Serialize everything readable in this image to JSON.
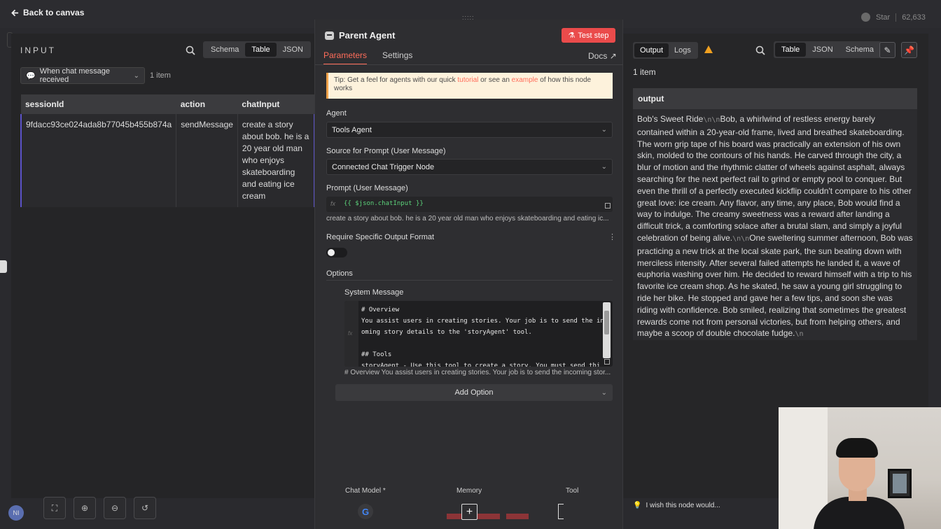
{
  "topbar": {
    "back_label": "Back to canvas",
    "star_label": "Star",
    "star_count": "62,633"
  },
  "input_panel": {
    "title": "INPUT",
    "view_tabs": [
      "Schema",
      "Table",
      "JSON"
    ],
    "active_view": "Table",
    "node_select": "When chat message received",
    "item_count": "1 item",
    "columns": [
      "sessionId",
      "action",
      "chatInput"
    ],
    "rows": [
      [
        "9fdacc93ce024ada8b77045b455b874a",
        "sendMessage",
        "create a story about bob. he is a 20 year old man who enjoys skateboarding and eating ice cream"
      ]
    ]
  },
  "modal": {
    "title": "Parent Agent",
    "test_step": "Test step",
    "tabs": [
      "Parameters",
      "Settings"
    ],
    "active_tab": "Parameters",
    "docs": "Docs",
    "tip": {
      "prefix": "Tip: Get a feel for agents with our quick ",
      "link1": "tutorial",
      "middle": " or see an ",
      "link2": "example",
      "suffix": " of how this node works"
    },
    "agent_label": "Agent",
    "agent_value": "Tools Agent",
    "source_label": "Source for Prompt (User Message)",
    "source_value": "Connected Chat Trigger Node",
    "prompt_label": "Prompt (User Message)",
    "prompt_fx": "fx",
    "prompt_expression": "{{ $json.chatInput }}",
    "prompt_preview": "create a story about bob. he is a 20 year old man who enjoys skateboarding and eating ic...",
    "require_format_label": "Require Specific Output Format",
    "require_format_enabled": false,
    "options_label": "Options",
    "system_message_label": "System Message",
    "system_message_code": "# Overview\nYou assist users in creating stories. Your job is to send the inc\noming story details to the 'storyAgent' tool.\n\n## Tools\nstoryAgent - Use this tool to create a story. You must send thi",
    "system_message_preview": "# Overview You assist users in creating stories. Your job is to send the incoming stor...",
    "add_option": "Add Option",
    "connectors": {
      "chat_model": "Chat Model *",
      "memory": "Memory",
      "tool": "Tool",
      "google_glyph": "G",
      "plus_glyph": "+"
    }
  },
  "output_panel": {
    "tabs": [
      "Output",
      "Logs"
    ],
    "active_tab": "Output",
    "view_tabs": [
      "Table",
      "JSON",
      "Schema"
    ],
    "active_view": "Table",
    "item_count": "1 item",
    "column": "output",
    "text_parts": [
      {
        "t": "Bob's Sweet Ride",
        "esc": false
      },
      {
        "t": "\\n\\n",
        "esc": true
      },
      {
        "t": "Bob, a whirlwind of restless energy barely contained within a 20-year-old frame, lived and breathed skateboarding. The worn grip tape of his board was practically an extension of his own skin, molded to the contours of his hands. He carved through the city, a blur of motion and the rhythmic clatter of wheels against asphalt, always searching for the next perfect rail to grind or empty pool to conquer. But even the thrill of a perfectly executed kickflip couldn't compare to his other great love: ice cream. Any flavor, any time, any place, Bob would find a way to indulge. The creamy sweetness was a reward after landing a difficult trick, a comforting solace after a brutal slam, and simply a joyful celebration of being alive.",
        "esc": false
      },
      {
        "t": "\\n\\n",
        "esc": true
      },
      {
        "t": "One sweltering summer afternoon, Bob was practicing a new trick at the local skate park, the sun beating down with merciless intensity. After several failed attempts he landed it, a wave of euphoria washing over him. He decided to reward himself with a trip to his favorite ice cream shop. As he skated, he saw a young girl struggling to ride her bike. He stopped and gave her a few tips, and soon she was riding with confidence. Bob smiled, realizing that sometimes the greatest rewards come not from personal victories, but from helping others, and maybe a scoop of double chocolate fudge.",
        "esc": false
      },
      {
        "t": "\\n",
        "esc": true
      }
    ]
  },
  "footer": {
    "avatar_initials": "NI",
    "wish_text": "I wish this node would..."
  },
  "colors": {
    "accent": "#ff6d5a",
    "test_button": "#ea4b4b",
    "selection": "#5b52c7",
    "warning": "#f0a020",
    "expression": "#5cd17a"
  }
}
